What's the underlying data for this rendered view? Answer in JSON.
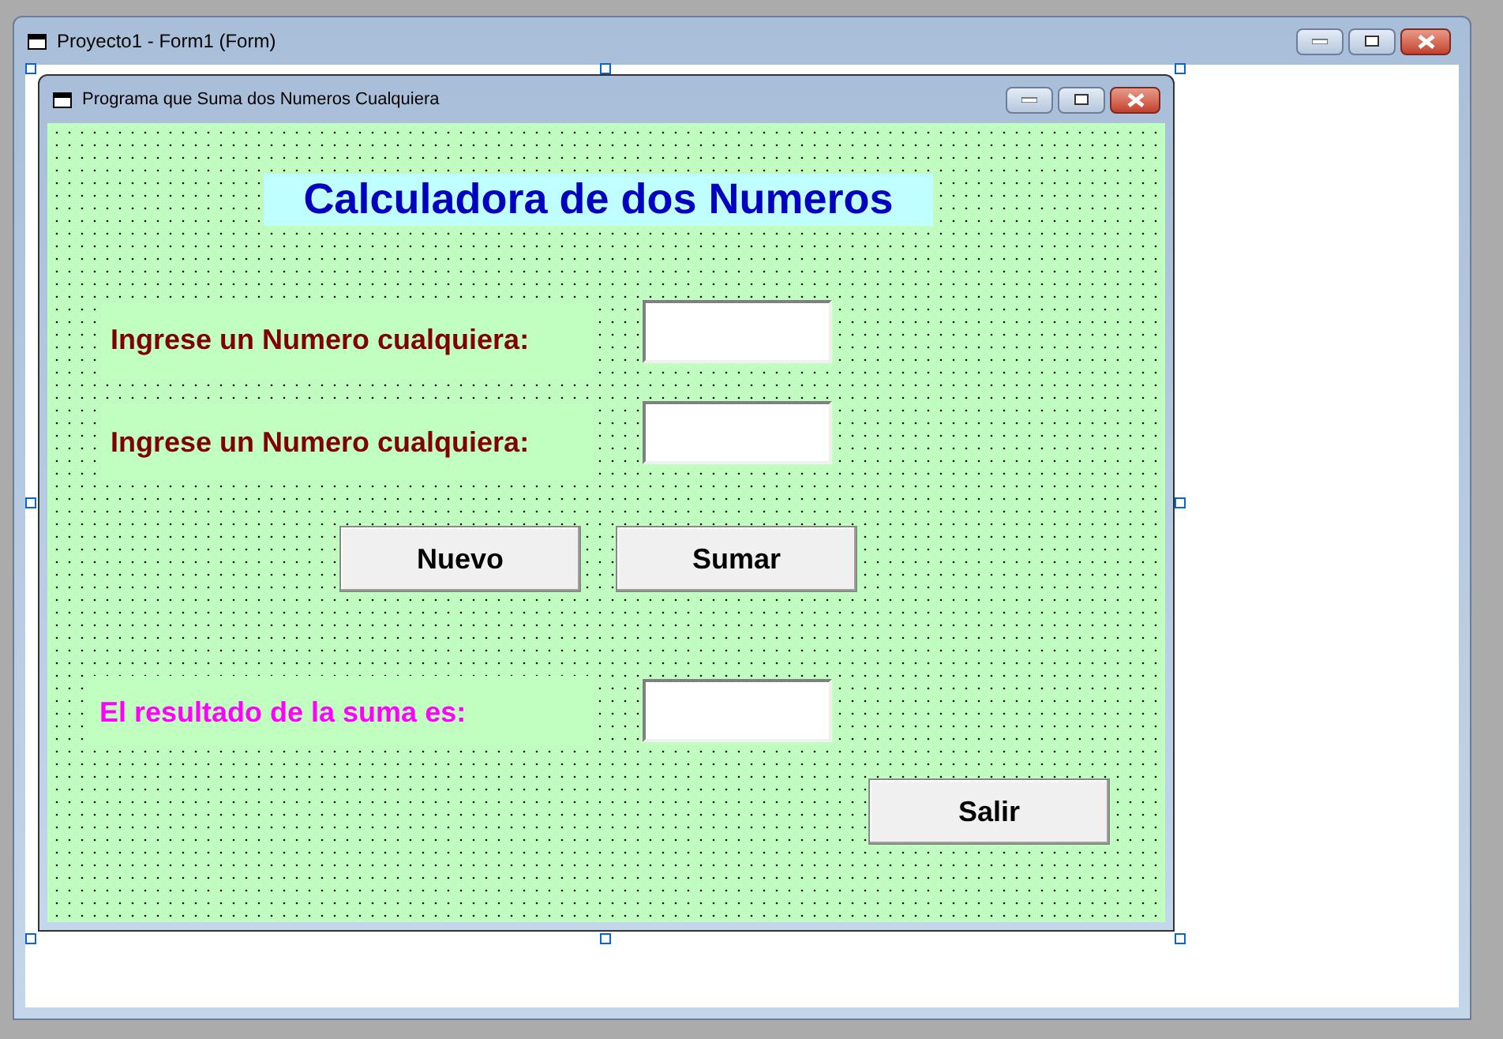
{
  "window": {
    "title": "Proyecto1 - Form1 (Form)"
  },
  "form": {
    "title": "Programa que Suma dos Numeros Cualquiera"
  },
  "controls": [
    {
      "kind": "title",
      "text": "Calculadora de dos Numeros",
      "color": "#0000c0"
    },
    {
      "kind": "label",
      "text": "Ingrese un Numero cualquiera:",
      "color": "#800000"
    },
    {
      "kind": "textbox"
    },
    {
      "kind": "label",
      "text": "Ingrese un Numero cualquiera:",
      "color": "#800000"
    },
    {
      "kind": "textbox"
    },
    {
      "kind": "button",
      "text": "Nuevo"
    },
    {
      "kind": "button",
      "text": "Sumar"
    },
    {
      "kind": "label",
      "text": "El resultado de la suma es:",
      "color": "#ff00ff"
    },
    {
      "kind": "textbox"
    },
    {
      "kind": "button",
      "text": "Salir"
    }
  ]
}
